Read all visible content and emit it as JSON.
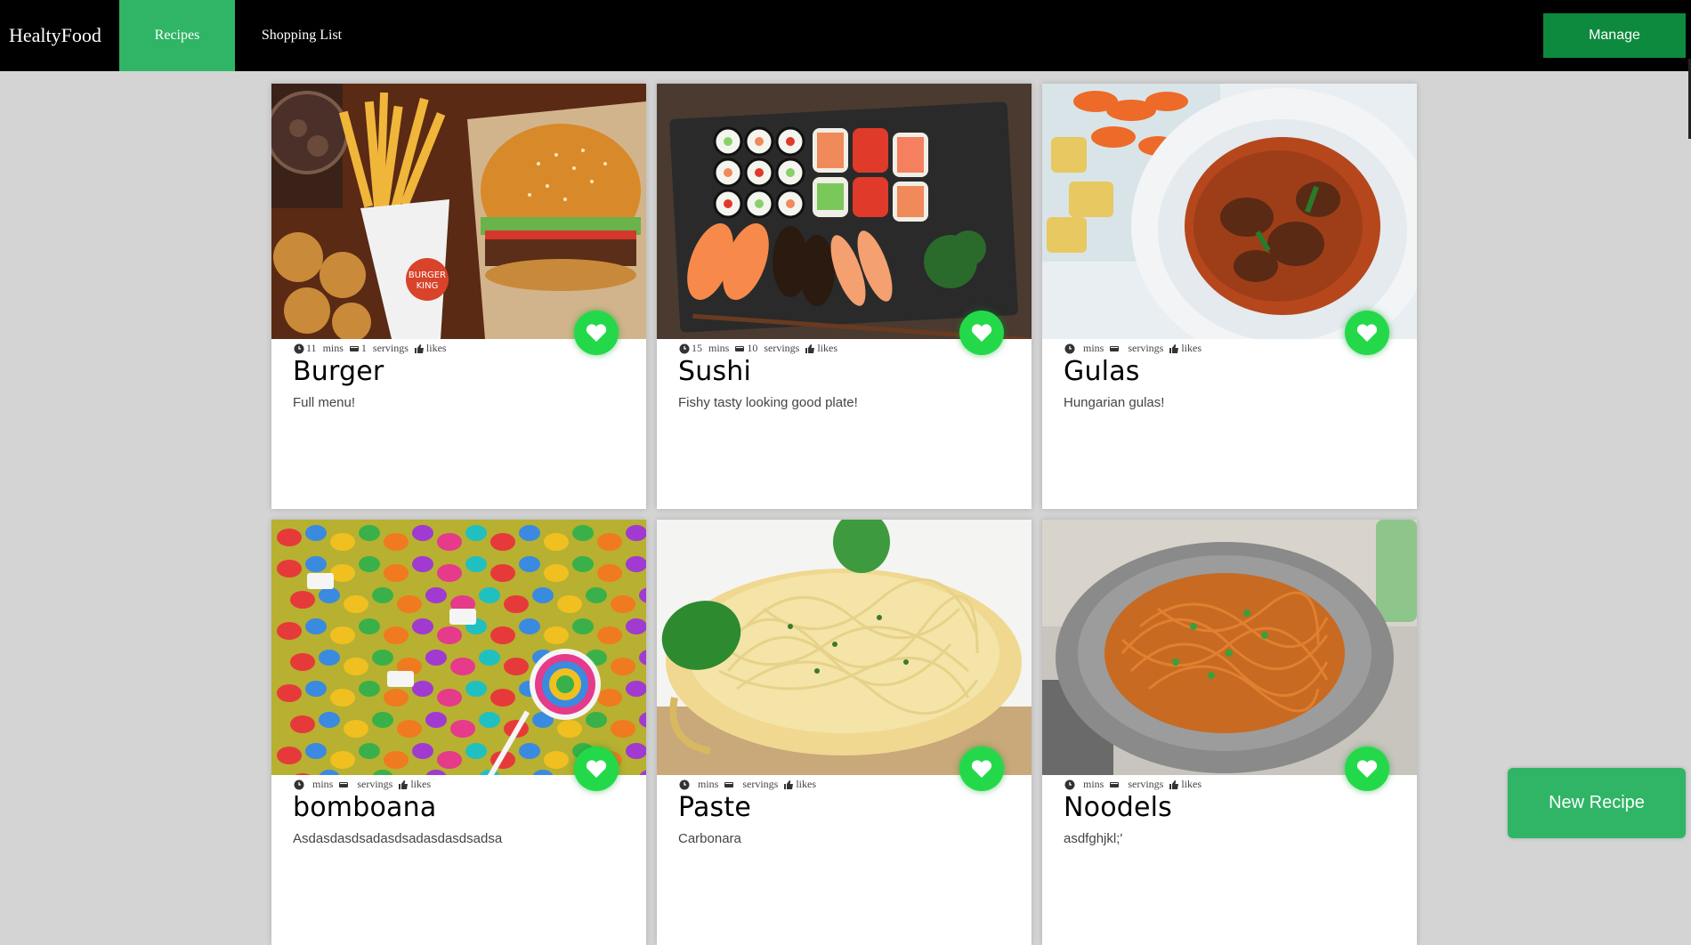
{
  "brand": "HealtyFood",
  "nav": {
    "recipes": "Recipes",
    "shopping_list": "Shopping List",
    "manage": "Manage"
  },
  "labels": {
    "mins": "mins",
    "servings": "servings",
    "likes": "likes"
  },
  "cards": [
    {
      "title": "Burger",
      "description": "Full menu!",
      "mins": "11",
      "servings": "1"
    },
    {
      "title": "Sushi",
      "description": "Fishy tasty looking good plate!",
      "mins": "15",
      "servings": "10"
    },
    {
      "title": "Gulas",
      "description": "Hungarian gulas!",
      "mins": "",
      "servings": ""
    },
    {
      "title": "bomboana",
      "description": "Asdasdasdsadasdsadasdasdsadsa",
      "mins": "",
      "servings": ""
    },
    {
      "title": "Paste",
      "description": "Carbonara",
      "mins": "",
      "servings": ""
    },
    {
      "title": "Noodels",
      "description": "asdfghjkl;'",
      "mins": "",
      "servings": ""
    }
  ],
  "new_recipe": "New Recipe",
  "colors": {
    "accent": "#2fb565",
    "manage": "#0d8a3e",
    "heart": "#23d94a"
  }
}
